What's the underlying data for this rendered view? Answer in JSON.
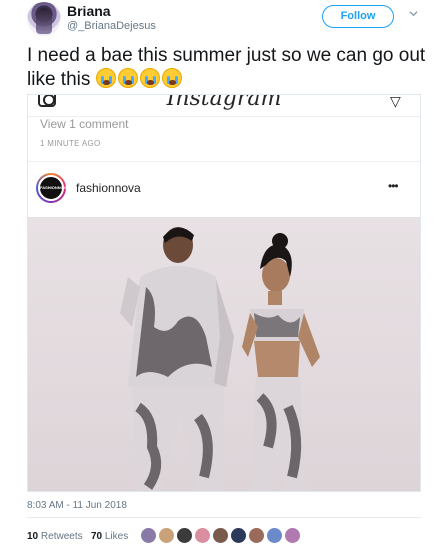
{
  "tweet": {
    "user": {
      "name": "Briana",
      "handle": "@_BrianaDejesus"
    },
    "follow_label": "Follow",
    "text": "I need a bae this summer just so we can go out like this",
    "emoji_count_note": "",
    "timestamp": "8:03 AM - 11 Jun 2018",
    "stats": {
      "retweets_count": "10",
      "retweets_label": "Retweets",
      "likes_count": "70",
      "likes_label": "Likes"
    },
    "liker_colors": [
      "#8a7aa8",
      "#c9a27a",
      "#3b3b3b",
      "#d98fa0",
      "#7a5a4a",
      "#2b3a5a",
      "#9a6a5a",
      "#6a8ac9",
      "#b07ab0"
    ]
  },
  "instagram": {
    "logo": "Instagram",
    "view_comments": "View 1 comment",
    "time_ago": "1 MINUTE AGO",
    "avatar_text": "FASHIONNOVA",
    "username": "fashionnova",
    "more": "•••"
  },
  "colors": {
    "accent": "#1da1f2",
    "text": "#14171a",
    "muted": "#657786"
  }
}
